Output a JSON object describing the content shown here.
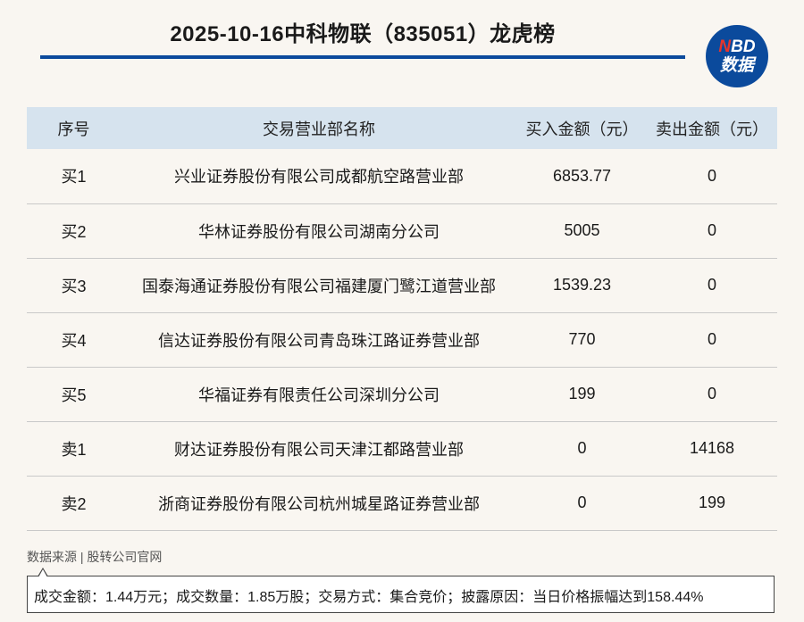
{
  "title": "2025-10-16中科物联（835051）龙虎榜",
  "logo": {
    "top": "NBD",
    "bottom": "数据"
  },
  "colors": {
    "accent": "#0b4a9c",
    "header_bg": "#d6e3ee",
    "logo_n": "#e8352b"
  },
  "table": {
    "headers": [
      "序号",
      "交易营业部名称",
      "买入金额（元）",
      "卖出金额（元）"
    ],
    "rows": [
      [
        "买1",
        "兴业证券股份有限公司成都航空路营业部",
        "6853.77",
        "0"
      ],
      [
        "买2",
        "华林证券股份有限公司湖南分公司",
        "5005",
        "0"
      ],
      [
        "买3",
        "国泰海通证券股份有限公司福建厦门鹭江道营业部",
        "1539.23",
        "0"
      ],
      [
        "买4",
        "信达证券股份有限公司青岛珠江路证券营业部",
        "770",
        "0"
      ],
      [
        "买5",
        "华福证券有限责任公司深圳分公司",
        "199",
        "0"
      ],
      [
        "卖1",
        "财达证券股份有限公司天津江都路营业部",
        "0",
        "14168"
      ],
      [
        "卖2",
        "浙商证券股份有限公司杭州城星路证券营业部",
        "0",
        "199"
      ]
    ]
  },
  "source": "数据来源 | 股转公司官网",
  "note": "成交金额：1.44万元；成交数量：1.85万股；交易方式：集合竞价；披露原因：当日价格振幅达到158.44%"
}
